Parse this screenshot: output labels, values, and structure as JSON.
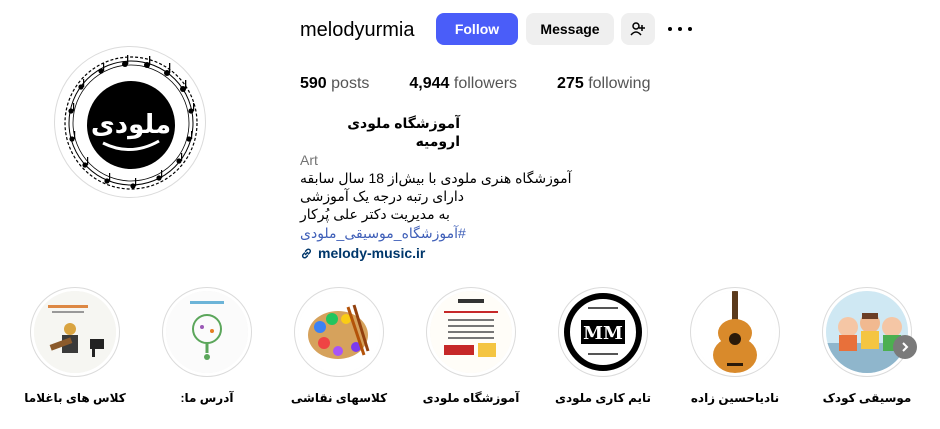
{
  "profile": {
    "username": "melodyurmia",
    "follow_label": "Follow",
    "message_label": "Message",
    "avatar_text": "ملودی",
    "stats": [
      {
        "count": "590",
        "label": "posts"
      },
      {
        "count": "4,944",
        "label": "followers"
      },
      {
        "count": "275",
        "label": "following"
      }
    ]
  },
  "bio": {
    "name": "آموزشگاه ملودی ارومیه",
    "category": "Art",
    "line1": "آموزشگاه هنری ملودی با بیش‌از 18 سال سابقه",
    "line2": "دارای رتبه درجه یک آموزشی",
    "line3": "به مدیریت دکتر علی پُرکار",
    "hashtag": "#آموزشگاه_موسیقی_ملودی",
    "link": "melody-music.ir"
  },
  "highlights": [
    {
      "label": "کلاس های باغلاما"
    },
    {
      "label": "آدرس ما:"
    },
    {
      "label": "کلاسهای نقاشی"
    },
    {
      "label": "آموزشگاه ملودی"
    },
    {
      "label": "تایم کاری ملودی"
    },
    {
      "label": "نادیاحسین زاده"
    },
    {
      "label": "موسیقی کودک"
    }
  ],
  "colors": {
    "follow_bg": "#4a5df9",
    "secondary_bg": "#efefef",
    "link": "#00376b",
    "hashtag": "#3f5fb8"
  }
}
